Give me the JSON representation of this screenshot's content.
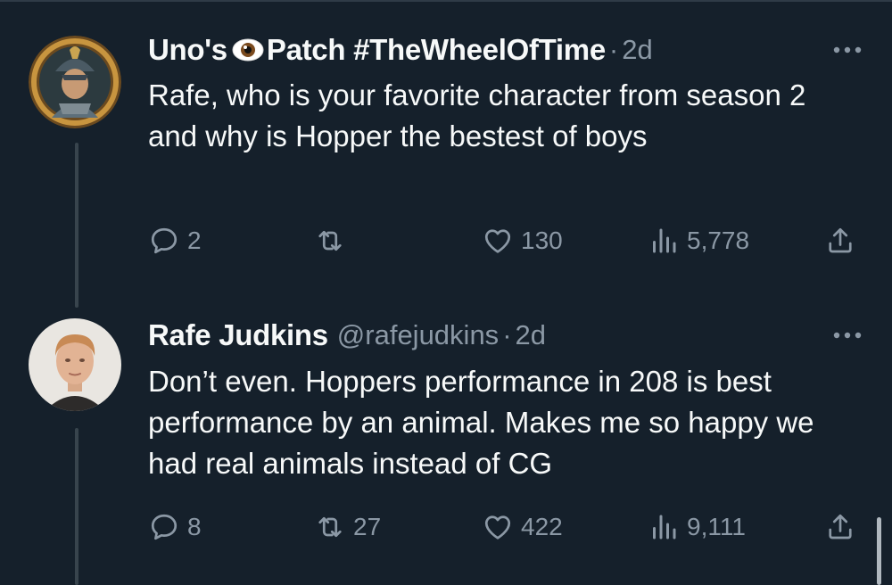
{
  "tweets": [
    {
      "author": {
        "name_part1": "Uno's",
        "name_part2": "Patch #TheWheelOfTime",
        "handle": "",
        "avatar_icon": "armored-warrior-avatar"
      },
      "separator": "·",
      "time": "2d",
      "text": "Rafe, who is your favorite character from season 2 and why is Hopper the bestest of boys",
      "stats": {
        "replies": "2",
        "retweets": "",
        "likes": "130",
        "views": "5,778"
      }
    },
    {
      "author": {
        "name": "Rafe Judkins",
        "handle": "@rafejudkins",
        "avatar_icon": "profile-photo-avatar"
      },
      "separator": "·",
      "time": "2d",
      "text": "Don’t even.  Hoppers performance in 208 is best performance by an animal.  Makes me so happy we had real animals instead of CG",
      "stats": {
        "replies": "8",
        "retweets": "27",
        "likes": "422",
        "views": "9,111"
      }
    }
  ],
  "colors": {
    "background": "#15202b",
    "text": "#f7f9f9",
    "muted": "#8b98a5",
    "thread_line": "#38444d"
  }
}
